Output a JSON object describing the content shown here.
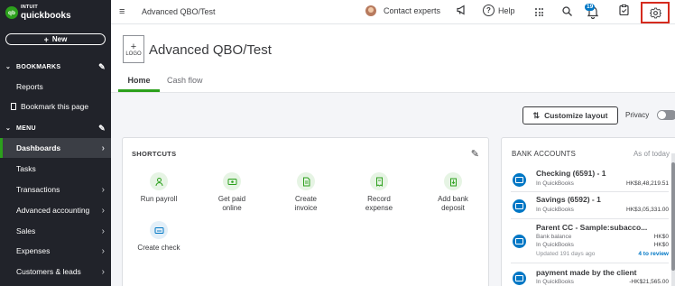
{
  "app": {
    "logo_top": "INTUIT",
    "logo_bottom": "quickbooks",
    "new_button": "New"
  },
  "sidebar": {
    "bookmarks_header": "BOOKMARKS",
    "menu_header": "MENU",
    "bookmark_items": [
      "Reports",
      "Bookmark this page"
    ],
    "menu_items": [
      {
        "label": "Dashboards",
        "active": true
      },
      {
        "label": "Tasks"
      },
      {
        "label": "Transactions"
      },
      {
        "label": "Advanced accounting"
      },
      {
        "label": "Sales"
      },
      {
        "label": "Expenses"
      },
      {
        "label": "Customers & leads"
      }
    ]
  },
  "topbar": {
    "company_name": "Advanced QBO/Test",
    "contact_experts": "Contact experts",
    "help": "Help",
    "notification_count": "19"
  },
  "header": {
    "logo_placeholder": "LOGO",
    "title": "Advanced QBO/Test",
    "tabs": [
      "Home",
      "Cash flow"
    ]
  },
  "toolbar": {
    "customize_layout": "Customize layout",
    "privacy": "Privacy"
  },
  "shortcuts": {
    "title": "SHORTCUTS",
    "items": [
      {
        "line1": "Run payroll",
        "line2": "",
        "icon": "payroll-icon"
      },
      {
        "line1": "Get paid",
        "line2": "online",
        "icon": "get-paid-icon"
      },
      {
        "line1": "Create",
        "line2": "invoice",
        "icon": "invoice-icon"
      },
      {
        "line1": "Record",
        "line2": "expense",
        "icon": "expense-icon"
      },
      {
        "line1": "Add bank",
        "line2": "deposit",
        "icon": "deposit-icon"
      },
      {
        "line1": "Create check",
        "line2": "",
        "icon": "check-icon"
      }
    ]
  },
  "bank_accounts": {
    "title": "BANK ACCOUNTS",
    "as_of": "As of today",
    "accounts": [
      {
        "name": "Checking (6591) - 1",
        "line1_label": "In QuickBooks",
        "line1_value": "HK$8,48,219.51"
      },
      {
        "name": "Savings (6592) - 1",
        "line1_label": "In QuickBooks",
        "line1_value": "HK$3,05,331.00"
      },
      {
        "name": "Parent CC - Sample:subacco...",
        "line1_label": "Bank balance",
        "line1_value": "HK$0",
        "line2_label": "In QuickBooks",
        "line2_value": "HK$0",
        "updated": "Updated 191 days ago",
        "review": "4 to review"
      },
      {
        "name": "payment made by the client",
        "line1_label": "In QuickBooks",
        "line1_value": "-HK$21,565.00"
      }
    ]
  },
  "colors": {
    "sidebar_bg": "#21232a",
    "brand_green": "#2ca01c",
    "link_blue": "#0077c5",
    "highlight_red": "#d52b1e"
  }
}
